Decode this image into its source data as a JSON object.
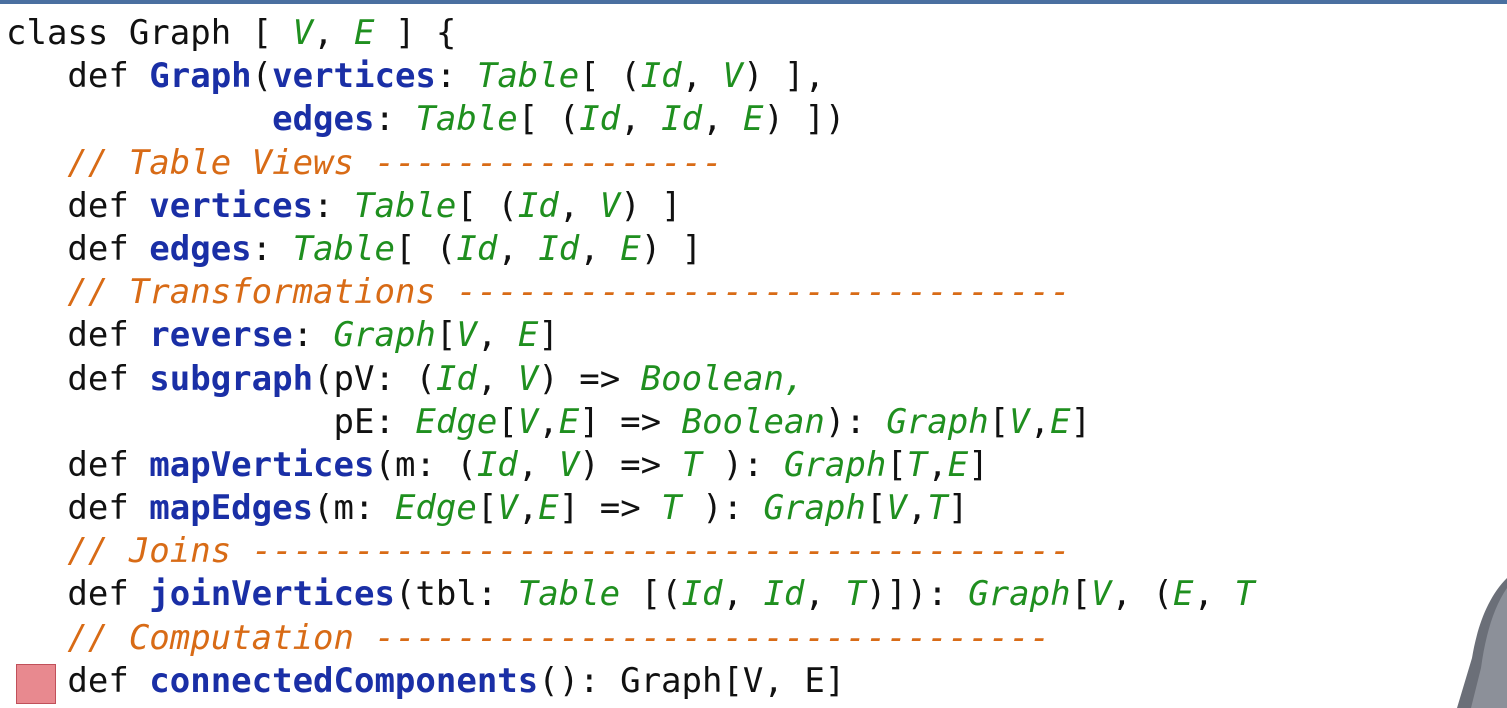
{
  "code_lines": [
    [
      {
        "t": "class Graph [ ",
        "c": "kw"
      },
      {
        "t": "V",
        "c": "ty"
      },
      {
        "t": ", ",
        "c": "kw"
      },
      {
        "t": "E",
        "c": "ty"
      },
      {
        "t": " ] {",
        "c": "kw"
      }
    ],
    [
      {
        "t": "   def ",
        "c": "kw"
      },
      {
        "t": "Graph",
        "c": "fn"
      },
      {
        "t": "(",
        "c": "kw"
      },
      {
        "t": "vertices",
        "c": "fn"
      },
      {
        "t": ": ",
        "c": "kw"
      },
      {
        "t": "Table",
        "c": "ty"
      },
      {
        "t": "[ (",
        "c": "kw"
      },
      {
        "t": "Id",
        "c": "ty"
      },
      {
        "t": ", ",
        "c": "kw"
      },
      {
        "t": "V",
        "c": "ty"
      },
      {
        "t": ") ],",
        "c": "kw"
      }
    ],
    [
      {
        "t": "             ",
        "c": "kw"
      },
      {
        "t": "edges",
        "c": "fn"
      },
      {
        "t": ": ",
        "c": "kw"
      },
      {
        "t": "Table",
        "c": "ty"
      },
      {
        "t": "[ (",
        "c": "kw"
      },
      {
        "t": "Id",
        "c": "ty"
      },
      {
        "t": ", ",
        "c": "kw"
      },
      {
        "t": "Id",
        "c": "ty"
      },
      {
        "t": ", ",
        "c": "kw"
      },
      {
        "t": "E",
        "c": "ty"
      },
      {
        "t": ") ])",
        "c": "kw"
      }
    ],
    [
      {
        "t": "   ",
        "c": "kw"
      },
      {
        "t": "// Table Views -----------------",
        "c": "cm"
      }
    ],
    [
      {
        "t": "   def ",
        "c": "kw"
      },
      {
        "t": "vertices",
        "c": "fn"
      },
      {
        "t": ": ",
        "c": "kw"
      },
      {
        "t": "Table",
        "c": "ty"
      },
      {
        "t": "[ (",
        "c": "kw"
      },
      {
        "t": "Id",
        "c": "ty"
      },
      {
        "t": ", ",
        "c": "kw"
      },
      {
        "t": "V",
        "c": "ty"
      },
      {
        "t": ") ]",
        "c": "kw"
      }
    ],
    [
      {
        "t": "   def ",
        "c": "kw"
      },
      {
        "t": "edges",
        "c": "fn"
      },
      {
        "t": ": ",
        "c": "kw"
      },
      {
        "t": "Table",
        "c": "ty"
      },
      {
        "t": "[ (",
        "c": "kw"
      },
      {
        "t": "Id",
        "c": "ty"
      },
      {
        "t": ", ",
        "c": "kw"
      },
      {
        "t": "Id",
        "c": "ty"
      },
      {
        "t": ", ",
        "c": "kw"
      },
      {
        "t": "E",
        "c": "ty"
      },
      {
        "t": ") ]",
        "c": "kw"
      }
    ],
    [
      {
        "t": "   ",
        "c": "kw"
      },
      {
        "t": "// Transformations ------------------------------",
        "c": "cm"
      }
    ],
    [
      {
        "t": "   def ",
        "c": "kw"
      },
      {
        "t": "reverse",
        "c": "fn"
      },
      {
        "t": ": ",
        "c": "kw"
      },
      {
        "t": "Graph",
        "c": "ty"
      },
      {
        "t": "[",
        "c": "kw"
      },
      {
        "t": "V",
        "c": "ty"
      },
      {
        "t": ", ",
        "c": "kw"
      },
      {
        "t": "E",
        "c": "ty"
      },
      {
        "t": "]",
        "c": "kw"
      }
    ],
    [
      {
        "t": "   def ",
        "c": "kw"
      },
      {
        "t": "subgraph",
        "c": "fn"
      },
      {
        "t": "(pV: (",
        "c": "kw"
      },
      {
        "t": "Id",
        "c": "ty"
      },
      {
        "t": ", ",
        "c": "kw"
      },
      {
        "t": "V",
        "c": "ty"
      },
      {
        "t": ") => ",
        "c": "kw"
      },
      {
        "t": "Boolean,",
        "c": "ty"
      }
    ],
    [
      {
        "t": "                pE: ",
        "c": "kw"
      },
      {
        "t": "Edge",
        "c": "ty"
      },
      {
        "t": "[",
        "c": "kw"
      },
      {
        "t": "V",
        "c": "ty"
      },
      {
        "t": ",",
        "c": "kw"
      },
      {
        "t": "E",
        "c": "ty"
      },
      {
        "t": "] => ",
        "c": "kw"
      },
      {
        "t": "Boolean",
        "c": "ty"
      },
      {
        "t": "): ",
        "c": "kw"
      },
      {
        "t": "Graph",
        "c": "ty"
      },
      {
        "t": "[",
        "c": "kw"
      },
      {
        "t": "V",
        "c": "ty"
      },
      {
        "t": ",",
        "c": "kw"
      },
      {
        "t": "E",
        "c": "ty"
      },
      {
        "t": "]",
        "c": "kw"
      }
    ],
    [
      {
        "t": "   def ",
        "c": "kw"
      },
      {
        "t": "mapVertices",
        "c": "fn"
      },
      {
        "t": "(m: (",
        "c": "kw"
      },
      {
        "t": "Id",
        "c": "ty"
      },
      {
        "t": ", ",
        "c": "kw"
      },
      {
        "t": "V",
        "c": "ty"
      },
      {
        "t": ") => ",
        "c": "kw"
      },
      {
        "t": "T",
        "c": "ty"
      },
      {
        "t": " ): ",
        "c": "kw"
      },
      {
        "t": "Graph",
        "c": "ty"
      },
      {
        "t": "[",
        "c": "kw"
      },
      {
        "t": "T",
        "c": "ty"
      },
      {
        "t": ",",
        "c": "kw"
      },
      {
        "t": "E",
        "c": "ty"
      },
      {
        "t": "]",
        "c": "kw"
      }
    ],
    [
      {
        "t": "   def ",
        "c": "kw"
      },
      {
        "t": "mapEdges",
        "c": "fn"
      },
      {
        "t": "(m: ",
        "c": "kw"
      },
      {
        "t": "Edge",
        "c": "ty"
      },
      {
        "t": "[",
        "c": "kw"
      },
      {
        "t": "V",
        "c": "ty"
      },
      {
        "t": ",",
        "c": "kw"
      },
      {
        "t": "E",
        "c": "ty"
      },
      {
        "t": "] => ",
        "c": "kw"
      },
      {
        "t": "T",
        "c": "ty"
      },
      {
        "t": " ): ",
        "c": "kw"
      },
      {
        "t": "Graph",
        "c": "ty"
      },
      {
        "t": "[",
        "c": "kw"
      },
      {
        "t": "V",
        "c": "ty"
      },
      {
        "t": ",",
        "c": "kw"
      },
      {
        "t": "T",
        "c": "ty"
      },
      {
        "t": "]",
        "c": "kw"
      }
    ],
    [
      {
        "t": "   ",
        "c": "kw"
      },
      {
        "t": "// Joins ----------------------------------------",
        "c": "cm"
      }
    ],
    [
      {
        "t": "   def ",
        "c": "kw"
      },
      {
        "t": "joinVertices",
        "c": "fn"
      },
      {
        "t": "(tbl: ",
        "c": "kw"
      },
      {
        "t": "Table",
        "c": "ty"
      },
      {
        "t": " [(",
        "c": "kw"
      },
      {
        "t": "Id",
        "c": "ty"
      },
      {
        "t": ", ",
        "c": "kw"
      },
      {
        "t": "Id",
        "c": "ty"
      },
      {
        "t": ", ",
        "c": "kw"
      },
      {
        "t": "T",
        "c": "ty"
      },
      {
        "t": ")]): ",
        "c": "kw"
      },
      {
        "t": "Graph",
        "c": "ty"
      },
      {
        "t": "[",
        "c": "kw"
      },
      {
        "t": "V",
        "c": "ty"
      },
      {
        "t": ", (",
        "c": "kw"
      },
      {
        "t": "E",
        "c": "ty"
      },
      {
        "t": ", ",
        "c": "kw"
      },
      {
        "t": "T",
        "c": "ty"
      }
    ],
    [
      {
        "t": "   ",
        "c": "kw"
      },
      {
        "t": "// Computation ---------------------------------",
        "c": "cm"
      }
    ],
    [
      {
        "t": "   def ",
        "c": "kw"
      },
      {
        "t": "connectedComponents",
        "c": "fn"
      },
      {
        "t": "(): Graph[V, E]",
        "c": "kw"
      }
    ]
  ],
  "colors": {
    "keyword": "#111111",
    "function": "#1a2fa6",
    "type": "#1f8f1f",
    "comment": "#d86b16",
    "bullet": "#e8898f"
  }
}
